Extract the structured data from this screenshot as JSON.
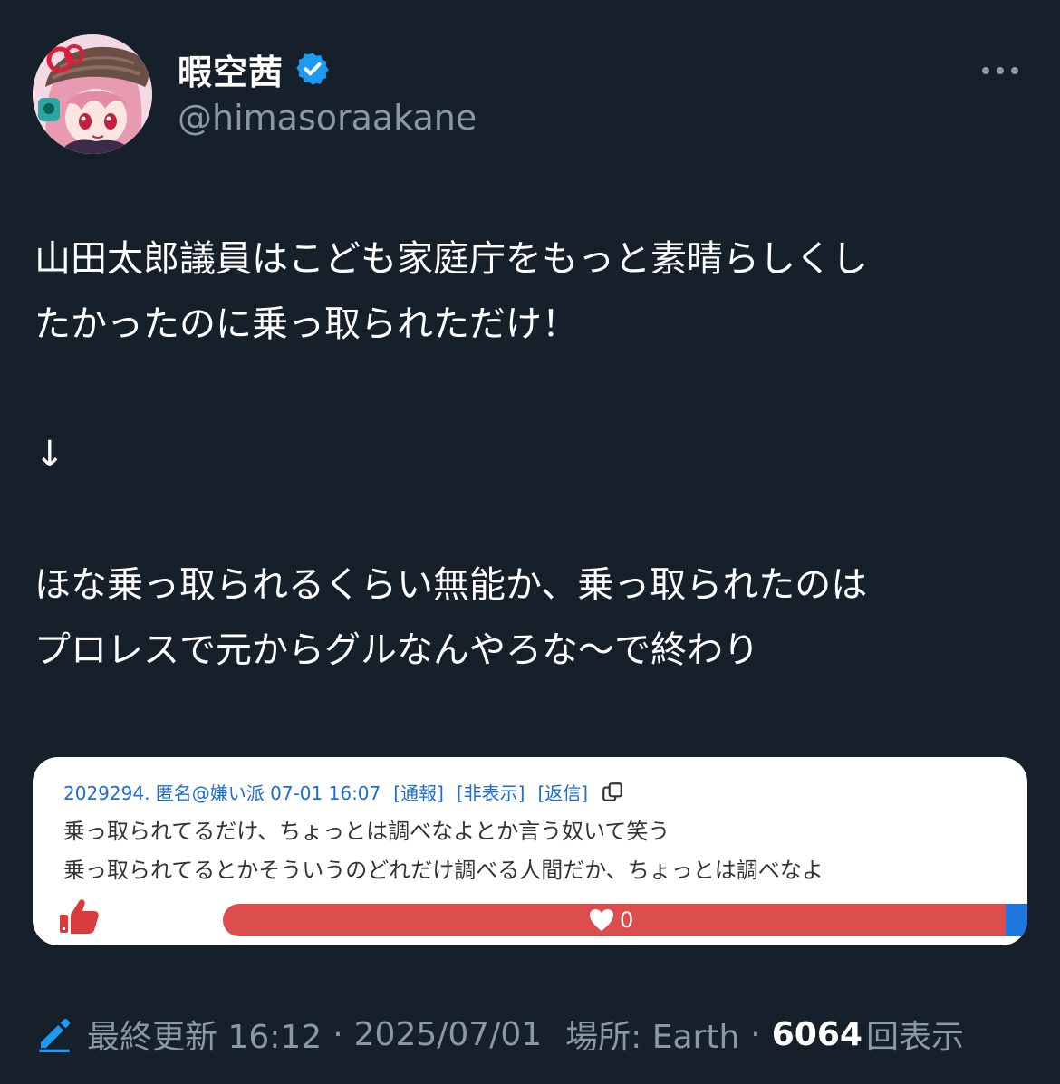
{
  "author": {
    "display_name": "暇空茜",
    "handle": "@himasoraakane",
    "verified_icon": "verified-badge-icon",
    "avatar_icon": "anime-character-avatar"
  },
  "more_icon": "more-dots-icon",
  "tweet": {
    "line1": "山田太郎議員はこども家庭庁をもっと素晴らしくし",
    "line2": "たかったのに乗っ取られただけ！",
    "arrow": "↓",
    "line3": "ほな乗っ取られるくらい無能か、乗っ取られたのは",
    "line4": "プロレスで元からグルなんやろな〜で終わり"
  },
  "embedded_post": {
    "meta": "2029294. 匿名@嫌い派 07-01 16:07",
    "report": "[通報]",
    "hide": "[非表示]",
    "reply": "[返信]",
    "copy_icon": "copy-icon",
    "body_line1": "乗っ取られてるだけ、ちょっとは調べなよとか言う奴いて笑う",
    "body_line2": "乗っ取られてるとかそういうのどれだけ調べる人間だか、ちょっとは調べなよ",
    "thumb_icon": "thumbs-up-icon",
    "heart_icon": "heart-icon",
    "heart_count": "0",
    "bar_red": "#dc4d4d",
    "bar_blue": "#1f77dd"
  },
  "footer": {
    "edit_icon": "edit-pencil-icon",
    "last_updated": "最終更新 16:12",
    "dot1": "·",
    "date": "2025/07/01",
    "location": "場所: Earth",
    "dot2": "·",
    "views": "6064",
    "views_label": "回表示"
  },
  "colors": {
    "background": "#15202b",
    "accent": "#1d9bf0",
    "muted": "#8b98a5"
  }
}
